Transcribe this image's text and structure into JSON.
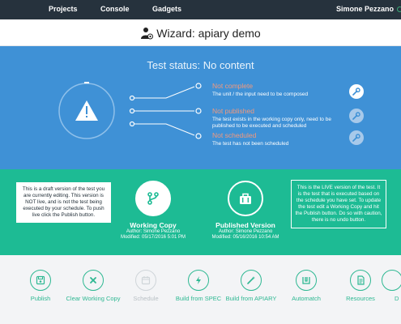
{
  "nav": {
    "items": [
      "Projects",
      "Console",
      "Gadgets"
    ],
    "user": "Simone Pezzano",
    "user_trail": "P"
  },
  "wizard": {
    "title": "Wizard: apiary demo"
  },
  "status": {
    "heading": "Test status: No content",
    "items": [
      {
        "label": "Not complete",
        "desc": "The unit / the input need to be composed"
      },
      {
        "label": "Not published",
        "desc": "The test exists in the working copy only, need to be published to be executed and scheduled"
      },
      {
        "label": "Not scheduled",
        "desc": "The test has not been scheduled"
      }
    ],
    "colors": {
      "background": "#3f91d6",
      "warning_label": "#f2997d"
    }
  },
  "versions": {
    "draft_note": "This is a draft version of the test you are currently editing. This version is NOT live, and is not the test being executed by your schedule. To push live click the Publish button.",
    "live_note": "This is the LIVE version of the test. It is the test that is executed based on the schedule you have set. To update the test edit a Working Copy and hit the Publish button. Do so with caution, there is no undo button.",
    "working": {
      "name": "Working Copy",
      "author": "Author: Simone Pezzano",
      "modified": "Modified: 05/17/2016 5:01 PM"
    },
    "published": {
      "name": "Published Version",
      "author": "Author: Simone Pezzano",
      "modified": "Modified: 05/16/2016 10:54 AM"
    },
    "colors": {
      "background": "#1dbb94"
    }
  },
  "actions": [
    {
      "label": "Publish",
      "icon": "save-icon",
      "enabled": true
    },
    {
      "label": "Clear Working Copy",
      "icon": "close-icon",
      "enabled": true
    },
    {
      "label": "Schedule",
      "icon": "calendar-icon",
      "enabled": false
    },
    {
      "label": "Build from SPEC",
      "icon": "lightning-icon",
      "enabled": true
    },
    {
      "label": "Build from APIARY",
      "icon": "wand-icon",
      "enabled": true
    },
    {
      "label": "Automatch",
      "icon": "automatch-icon",
      "enabled": true
    },
    {
      "label": "Resources",
      "icon": "document-icon",
      "enabled": true
    },
    {
      "label": "D",
      "icon": "partial-icon",
      "enabled": true
    }
  ],
  "accent": "#2eb892"
}
